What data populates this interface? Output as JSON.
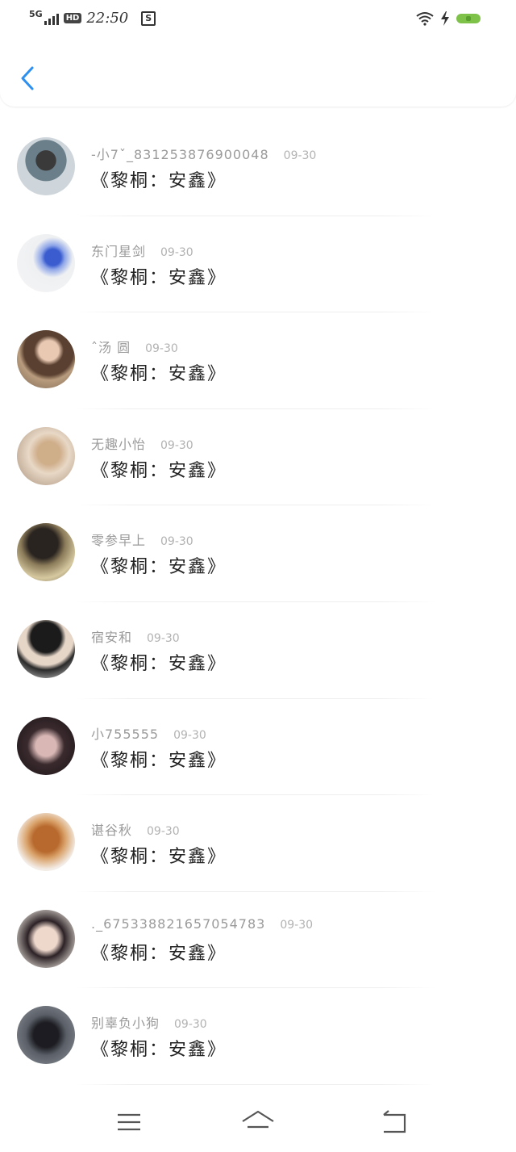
{
  "status_bar": {
    "network": "5G",
    "hd": "HD",
    "time": "22:50",
    "app_icon": "S",
    "battery_color": "#7fc24a"
  },
  "header": {
    "back_icon": "chevron-left-icon",
    "accent_color": "#2d8ff0"
  },
  "list": [
    {
      "name": "-小7ˇ_831253876900048",
      "date": "09-30",
      "message": "《黎桐：安鑫》"
    },
    {
      "name": "东门星剑",
      "date": "09-30",
      "message": "《黎桐：安鑫》"
    },
    {
      "name": "ˆ汤 圆",
      "date": "09-30",
      "message": "《黎桐：安鑫》"
    },
    {
      "name": "无趣小怡",
      "date": "09-30",
      "message": "《黎桐：安鑫》"
    },
    {
      "name": "零参早上",
      "date": "09-30",
      "message": "《黎桐：安鑫》"
    },
    {
      "name": "宿安和",
      "date": "09-30",
      "message": "《黎桐：安鑫》"
    },
    {
      "name": "小755555",
      "date": "09-30",
      "message": "《黎桐：安鑫》"
    },
    {
      "name": "谌谷秋",
      "date": "09-30",
      "message": "《黎桐：安鑫》"
    },
    {
      "name": "._6753388216570547​83",
      "date": "09-30",
      "message": "《黎桐：安鑫》"
    },
    {
      "name": "别辜负小狗",
      "date": "09-30",
      "message": "《黎桐：安鑫》"
    }
  ],
  "nav": {
    "menu_icon": "menu-icon",
    "home_icon": "home-icon",
    "back_icon": "back-icon"
  }
}
